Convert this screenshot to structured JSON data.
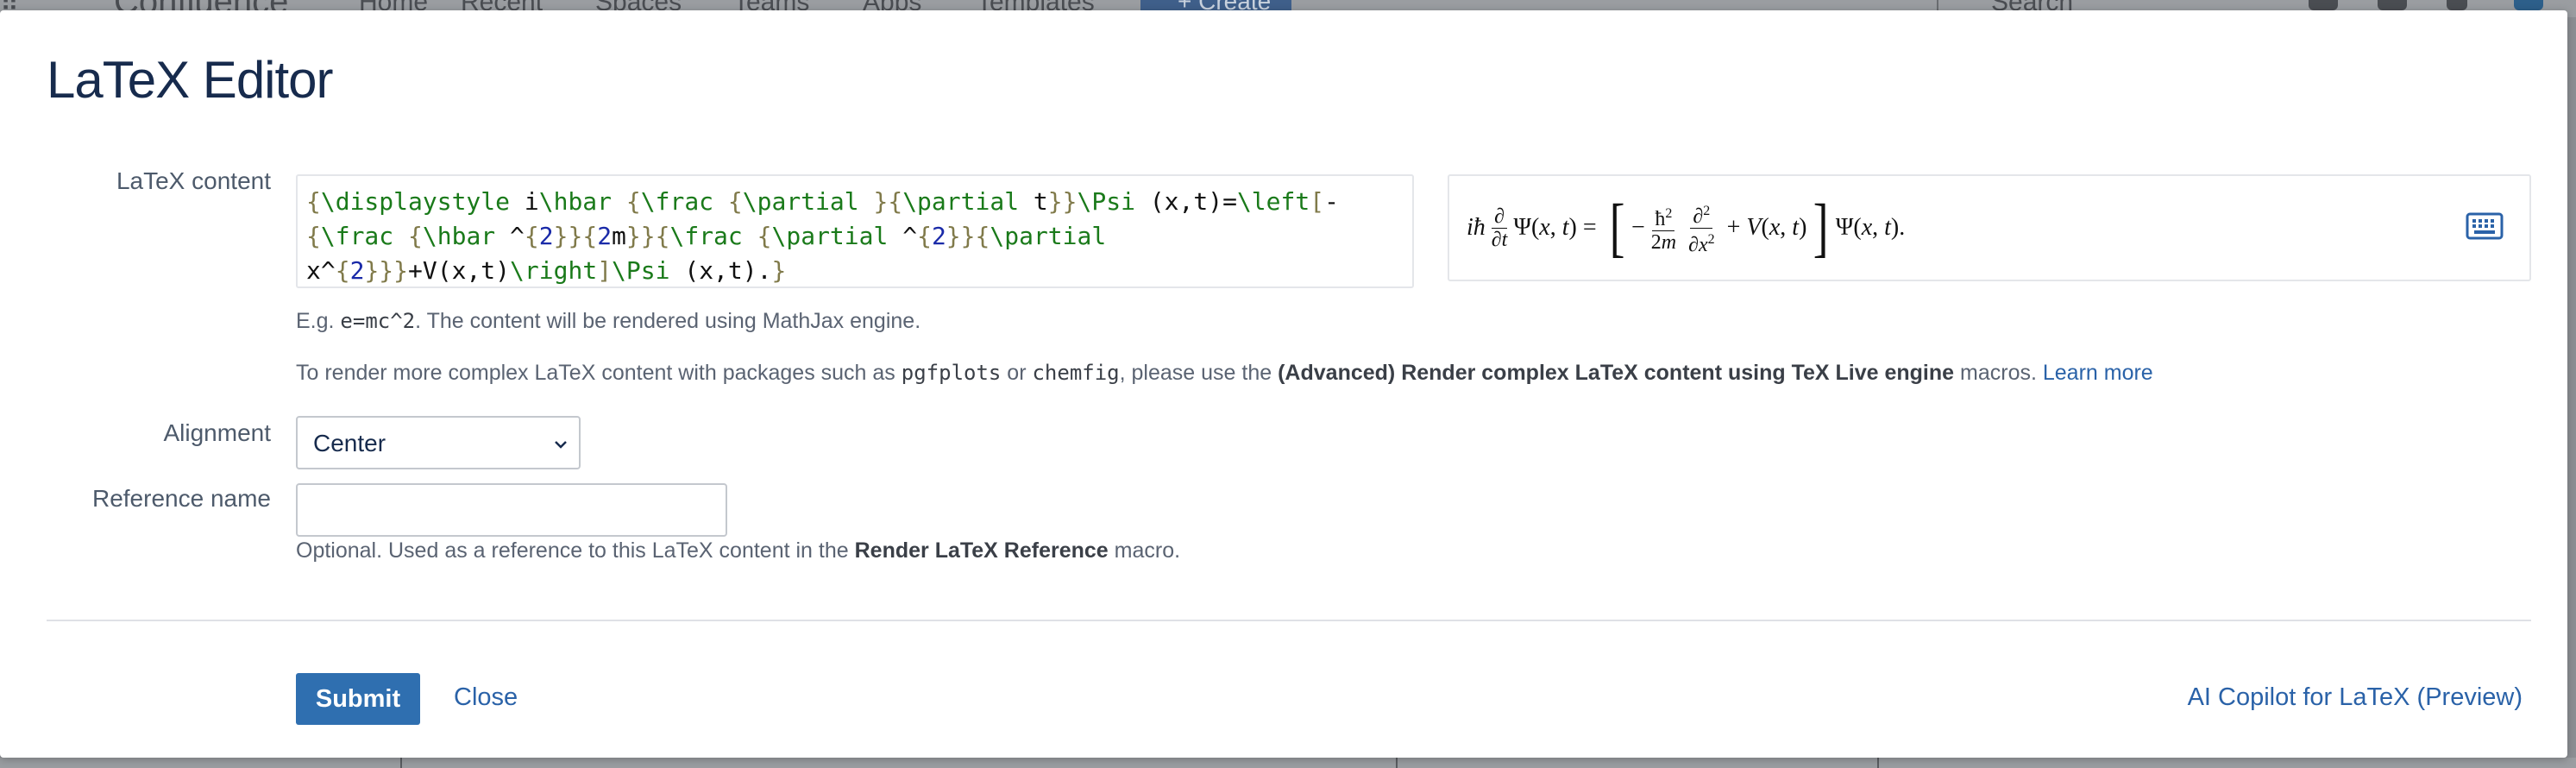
{
  "background_app": {
    "logo_text": "Confluence",
    "nav": [
      "Home",
      "Recent",
      "Spaces",
      "Teams",
      "Apps",
      "Templates"
    ],
    "create_label": "+ Create",
    "search_placeholder": "Search"
  },
  "dialog": {
    "title": "LaTeX Editor",
    "latex_content_label": "LaTeX content",
    "latex_source": "{\\displaystyle i\\hbar {\\frac {\\partial }{\\partial t}}\\Psi (x,t)=\\left[-{\\frac {\\hbar ^{2}}{2m}}{\\frac {\\partial ^{2}}{\\partial x^{2}}}+V(x,t)\\right]\\Psi (x,t).}",
    "example_prefix": "E.g. ",
    "example_code": "e=mc^2",
    "example_suffix": ". The content will be rendered using MathJax engine.",
    "complex_prefix": "To render more complex LaTeX content with packages such as ",
    "pkg1": "pgfplots",
    "complex_or": " or ",
    "pkg2": "chemfig",
    "complex_mid": ", please use the ",
    "complex_macro": "(Advanced) Render complex LaTeX content using TeX Live engine",
    "complex_suffix": " macros. ",
    "learn_more": "Learn more",
    "alignment_label": "Alignment",
    "alignment_value": "Center",
    "reference_label": "Reference name",
    "reference_value": "",
    "reference_help_prefix": "Optional. Used as a reference to this LaTeX content in the ",
    "reference_help_macro": "Render LaTeX Reference",
    "reference_help_suffix": " macro.",
    "submit_label": "Submit",
    "close_label": "Close",
    "copilot_label": "AI Copilot for LaTeX (Preview)"
  },
  "icons": [
    "keyboard-icon",
    "chevron-down-icon"
  ],
  "colors": {
    "primary": "#2f6fb0",
    "link": "#2a62a8",
    "title": "#172b4d"
  }
}
